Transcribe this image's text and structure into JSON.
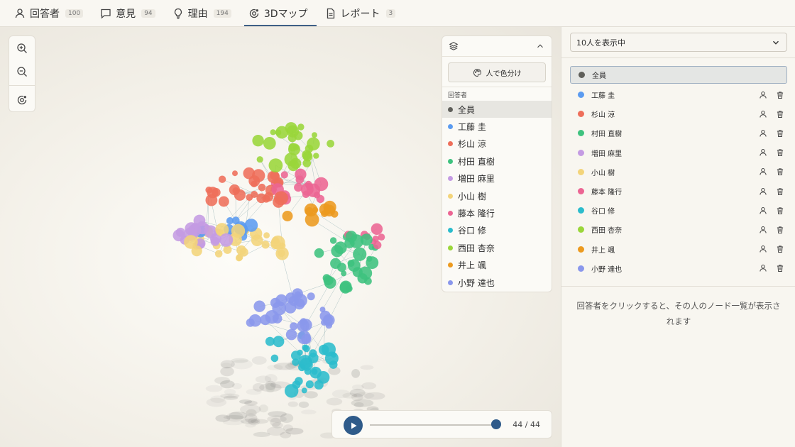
{
  "tabs": [
    {
      "label": "回答者",
      "count": "100",
      "icon": "person-icon"
    },
    {
      "label": "意見",
      "count": "94",
      "icon": "speech-bubble-icon"
    },
    {
      "label": "理由",
      "count": "194",
      "icon": "lightbulb-icon"
    },
    {
      "label": "3Dマップ",
      "count": "",
      "icon": "orbit-icon",
      "active": true
    },
    {
      "label": "レポート",
      "count": "3",
      "icon": "document-icon"
    }
  ],
  "layer_panel": {
    "color_button_label": "人で色分け",
    "section_label": "回答者",
    "items": [
      {
        "label": "全員",
        "color": "#5f5f5a",
        "selected": true
      },
      {
        "label": "工藤 圭",
        "color": "#5b9bf0"
      },
      {
        "label": "杉山 涼",
        "color": "#ee6e5a"
      },
      {
        "label": "村田 直樹",
        "color": "#3ec27e"
      },
      {
        "label": "増田 麻里",
        "color": "#c49be3"
      },
      {
        "label": "小山 樹",
        "color": "#f3d47a"
      },
      {
        "label": "藤本 隆行",
        "color": "#ec6593"
      },
      {
        "label": "谷口 修",
        "color": "#2bbccc"
      },
      {
        "label": "西田 杏奈",
        "color": "#9ad63a"
      },
      {
        "label": "井上 颯",
        "color": "#ec9a1f"
      },
      {
        "label": "小野 達也",
        "color": "#8a97ec"
      }
    ]
  },
  "player": {
    "time": "44 / 44",
    "progress": 1.0
  },
  "right_panel": {
    "select_value": "10人を表示中",
    "hint": "回答者をクリックすると、その人のノード一覧が表示されます",
    "items": [
      {
        "label": "全員",
        "color": "#5f5f5a",
        "selected": true,
        "actions": false
      },
      {
        "label": "工藤 圭",
        "color": "#5b9bf0",
        "actions": true
      },
      {
        "label": "杉山 涼",
        "color": "#ee6e5a",
        "actions": true
      },
      {
        "label": "村田 直樹",
        "color": "#3ec27e",
        "actions": true
      },
      {
        "label": "増田 麻里",
        "color": "#c49be3",
        "actions": true
      },
      {
        "label": "小山 樹",
        "color": "#f3d47a",
        "actions": true
      },
      {
        "label": "藤本 隆行",
        "color": "#ec6593",
        "actions": true
      },
      {
        "label": "谷口 修",
        "color": "#2bbccc",
        "actions": true
      },
      {
        "label": "西田 杏奈",
        "color": "#9ad63a",
        "actions": true
      },
      {
        "label": "井上 颯",
        "color": "#ec9a1f",
        "actions": true
      },
      {
        "label": "小野 達也",
        "color": "#8a97ec",
        "actions": true
      }
    ]
  }
}
